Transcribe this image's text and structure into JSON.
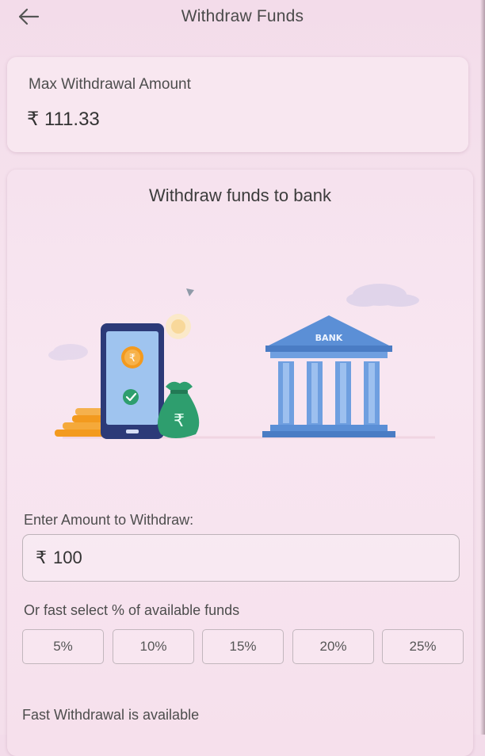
{
  "header": {
    "title": "Withdraw Funds",
    "back_icon": "arrow-left-icon"
  },
  "max_withdrawal": {
    "label": "Max Withdrawal Amount",
    "value": "₹ 111.33"
  },
  "withdraw_card": {
    "title": "Withdraw funds to bank",
    "illustration": {
      "bank_sign": "BANK",
      "phone_coin_symbol": "₹",
      "money_bag_symbol": "₹"
    },
    "amount_label": "Enter Amount to Withdraw:",
    "amount_input": {
      "currency_symbol": "₹",
      "value": "100"
    },
    "fast_select_label": "Or fast select % of available funds",
    "percent_options": [
      "5%",
      "10%",
      "15%",
      "20%",
      "25%"
    ],
    "fast_withdrawal_text": "Fast Withdrawal is available"
  },
  "colors": {
    "background": "#f4dfeb",
    "bank_blue": "#5b8fd6",
    "money_bag_green": "#2e9e6e",
    "coin_orange": "#f39a1e",
    "phone_dark": "#2c3a78"
  }
}
